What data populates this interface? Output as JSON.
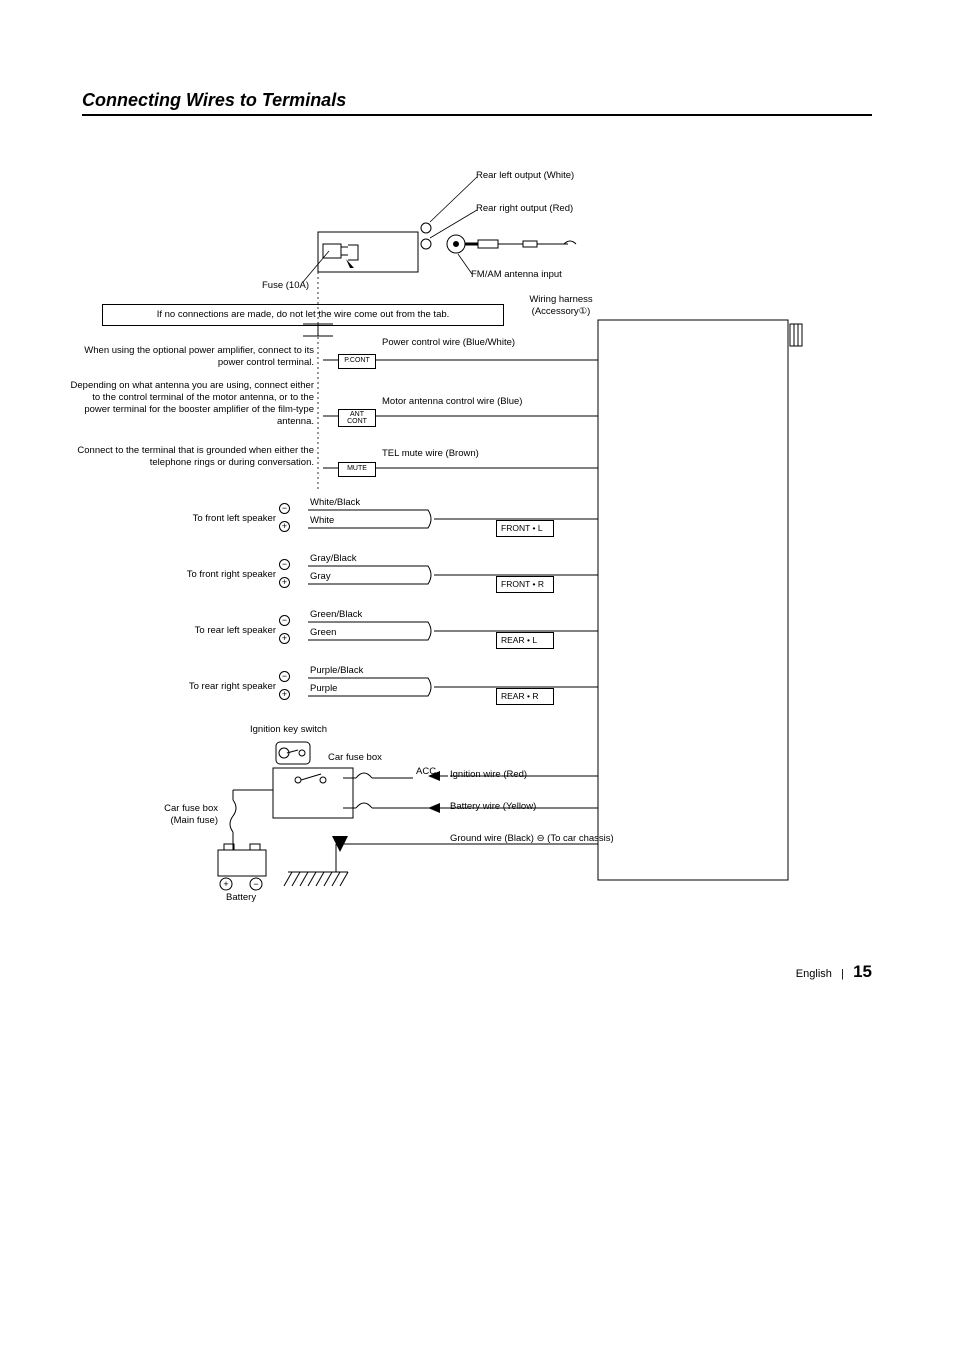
{
  "heading": "Connecting Wires to Terminals",
  "outputs": {
    "rear_left": "Rear left output (White)",
    "rear_right": "Rear right output (Red)",
    "antenna": "FM/AM antenna input",
    "fuse": "Fuse (10A)",
    "harness_top": "Wiring harness",
    "harness_bot": "(Accessory①)"
  },
  "tab_note": "If no connections are made, do not let the wire come out from the tab.",
  "remotes": {
    "pcont_note": "When using the optional power amplifier, connect to its power control terminal.",
    "pcont_label": "P.CONT",
    "pcont_wire": "Power control wire (Blue/White)",
    "ant_note": "Depending on what antenna you are using, connect either to the control terminal of the motor antenna, or to the power terminal for the booster amplifier of the film-type antenna.",
    "ant_label_top": "ANT",
    "ant_label_bot": "CONT",
    "ant_wire": "Motor antenna control wire (Blue)",
    "mute_note": "Connect to the terminal that is grounded when either the telephone rings or during conversation.",
    "mute_label": "MUTE",
    "mute_wire": "TEL mute wire (Brown)"
  },
  "speakers": {
    "fl_target": "To front left speaker",
    "fl_neg": "White/Black",
    "fl_pos": "White",
    "fl_pin": "FRONT • L",
    "fr_target": "To front right speaker",
    "fr_neg": "Gray/Black",
    "fr_pos": "Gray",
    "fr_pin": "FRONT • R",
    "rl_target": "To rear left speaker",
    "rl_neg": "Green/Black",
    "rl_pos": "Green",
    "rl_pin": "REAR • L",
    "rr_target": "To rear right speaker",
    "rr_neg": "Purple/Black",
    "rr_pos": "Purple",
    "rr_pin": "REAR • R"
  },
  "power": {
    "ign_switch": "Ignition key switch",
    "car_fuse_box": "Car fuse box",
    "acc": "ACC",
    "ign_wire": "Ignition wire (Red)",
    "batt_wire": "Battery wire (Yellow)",
    "gnd_wire": "Ground wire (Black) ⊖ (To car chassis)",
    "main_fuse_top": "Car fuse box",
    "main_fuse_bot": "(Main fuse)",
    "battery": "Battery"
  },
  "footer": {
    "lang": "English",
    "sep": "|",
    "page": "15"
  }
}
